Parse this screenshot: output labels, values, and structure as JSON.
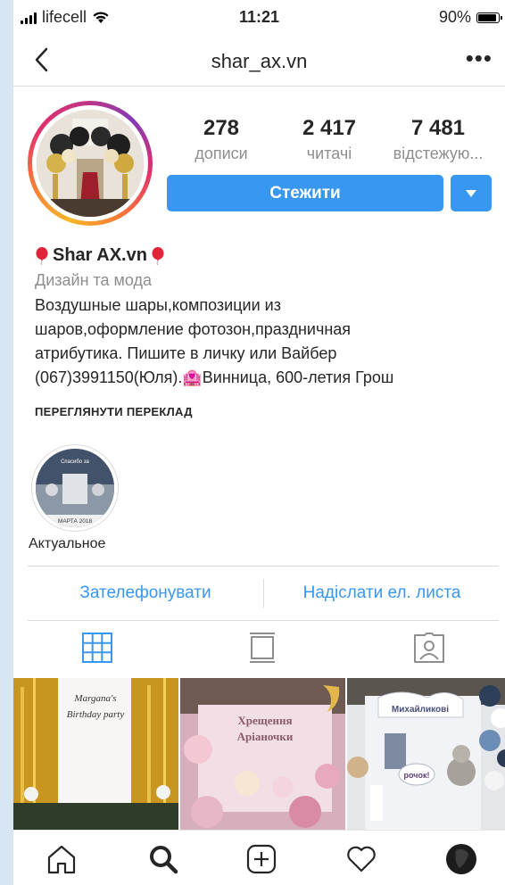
{
  "status_bar": {
    "carrier": "lifecell",
    "time": "11:21",
    "battery": "90%",
    "battery_level": 0.9
  },
  "nav": {
    "title": "shar_ax.vn",
    "more": "•••"
  },
  "stats": [
    {
      "value": "278",
      "label": "дописи"
    },
    {
      "value": "2 417",
      "label": "читачі"
    },
    {
      "value": "7 481",
      "label": "відстежую..."
    }
  ],
  "follow_label": "Стежити",
  "bio": {
    "name": "Shar AX.vn",
    "category": "Дизайн та мода",
    "lines": [
      "Воздушные шары,композиции из",
      "шаров,оформление фотозон,праздничная",
      "атрибутика. Пишите в личку или Вайбер",
      "(067)3991150(Юля).🏩Винница, 600-летия Грош"
    ]
  },
  "translate_label": "ПЕРЕГЛЯНУТИ ПЕРЕКЛАД",
  "highlight": {
    "label": "Актуальное",
    "caption_top": "Спасибо за",
    "caption_bottom": "МАРТА 2018"
  },
  "contacts": {
    "call": "Зателефонувати",
    "email": "Надіслати ел. листа"
  },
  "posts": [
    {
      "text_line1": "Margana's",
      "text_line2": "Birthday party"
    },
    {
      "text_line1": "Хрещення",
      "text_line2": "Аріаночки"
    },
    {
      "text_line1": "Михайликові",
      "text_line2": "рочок!"
    }
  ],
  "icons": {
    "back": "chevron-left-icon",
    "tabs": [
      "grid-icon",
      "feed-icon",
      "tagged-icon"
    ],
    "tabbar": [
      "home-icon",
      "search-icon",
      "add-icon",
      "heart-icon",
      "profile-avatar"
    ]
  },
  "colors": {
    "accent": "#3897f0",
    "secondary_text": "#8e8e8e",
    "divider": "#dbdbdb"
  }
}
